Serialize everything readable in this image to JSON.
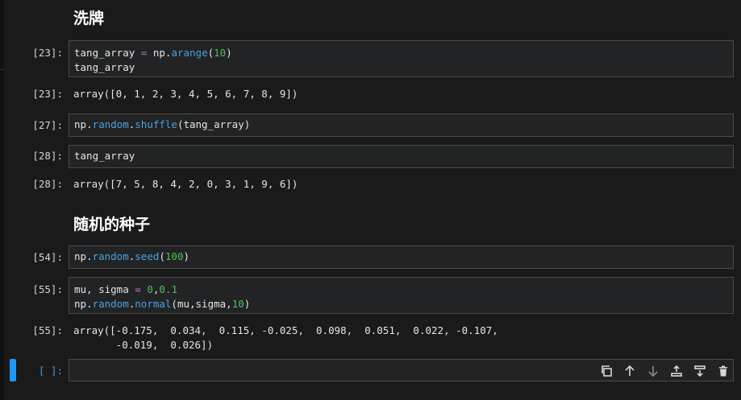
{
  "headings": {
    "shuffle": "洗牌",
    "seed": "随机的种子"
  },
  "cells": {
    "c23": {
      "prompt": "[23]:",
      "line1_a": "tang_array",
      "line1_op": "=",
      "line1_b": "np.",
      "line1_fn": "arange",
      "line1_c": "(",
      "line1_num": "10",
      "line1_d": ")",
      "line2": "tang_array"
    },
    "o23": {
      "prompt": "[23]:",
      "text": "array([0, 1, 2, 3, 4, 5, 6, 7, 8, 9])"
    },
    "c27": {
      "prompt": "[27]:",
      "a": "np.",
      "fn1": "random",
      "b": ".",
      "fn2": "shuffle",
      "c": "(tang_array)"
    },
    "c28": {
      "prompt": "[28]:",
      "text": "tang_array"
    },
    "o28": {
      "prompt": "[28]:",
      "text": "array([7, 5, 8, 4, 2, 0, 3, 1, 9, 6])"
    },
    "c54": {
      "prompt": "[54]:",
      "a": "np.",
      "fn1": "random",
      "b": ".",
      "fn2": "seed",
      "c": "(",
      "num": "100",
      "d": ")"
    },
    "c55": {
      "prompt": "[55]:",
      "l1_a": "mu, sigma ",
      "l1_op": "=",
      "l1_b": " ",
      "l1_n1": "0",
      "l1_c": ",",
      "l1_n2": "0.1",
      "l2_a": "np.",
      "l2_fn1": "random",
      "l2_b": ".",
      "l2_fn2": "normal",
      "l2_c": "(mu,sigma,",
      "l2_num": "10",
      "l2_d": ")"
    },
    "o55": {
      "prompt": "[55]:",
      "line1": "array([-0.175,  0.034,  0.115, -0.025,  0.098,  0.051,  0.022, -0.107,",
      "line2": "       -0.019,  0.026])"
    },
    "empty": {
      "prompt": "[ ]:"
    }
  },
  "toolbar": {
    "icons": [
      "duplicate-icon",
      "move-up-icon",
      "move-down-icon",
      "insert-above-icon",
      "insert-below-icon",
      "delete-icon"
    ]
  },
  "colors": {
    "background": "#1a1a1a",
    "cell_bg": "#222324",
    "active_bar": "#2196f3",
    "syntax_function": "#4aa3df",
    "syntax_number": "#4fc060",
    "syntax_operator": "#c678dd"
  }
}
